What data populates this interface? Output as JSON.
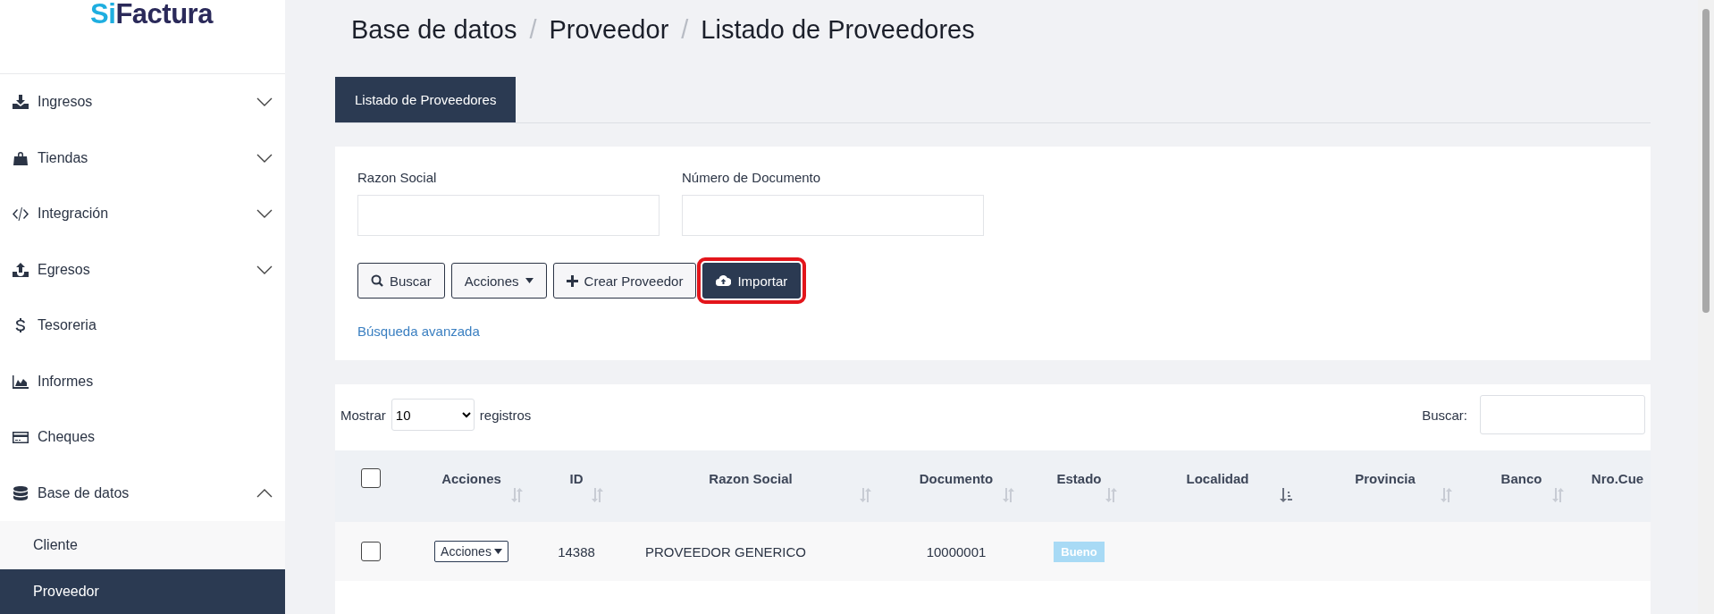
{
  "sidebar": {
    "logo": {
      "accent": "Si",
      "rest": "Factura"
    },
    "items": [
      {
        "label": "Ingresos",
        "expanded": false
      },
      {
        "label": "Tiendas",
        "expanded": false
      },
      {
        "label": "Integración",
        "expanded": false
      },
      {
        "label": "Egresos",
        "expanded": false
      },
      {
        "label": "Tesoreria"
      },
      {
        "label": "Informes"
      },
      {
        "label": "Cheques"
      },
      {
        "label": "Base de datos",
        "expanded": true,
        "children": [
          {
            "label": "Cliente",
            "selected": false
          },
          {
            "label": "Proveedor",
            "selected": true
          }
        ]
      }
    ]
  },
  "breadcrumb": {
    "separator": "/",
    "items": [
      "Base de datos",
      "Proveedor",
      "Listado de Proveedores"
    ]
  },
  "tabs": [
    {
      "label": "Listado de Proveedores",
      "selected": true
    }
  ],
  "filters": {
    "fields": [
      {
        "label": "Razon Social"
      },
      {
        "label": "Número de Documento"
      }
    ],
    "buttons": [
      {
        "label": "Buscar",
        "kind": "search",
        "highlighted": false
      },
      {
        "label": "Acciones",
        "kind": "dropdown",
        "highlighted": false
      },
      {
        "label": "Crear Proveedor",
        "kind": "create",
        "highlighted": false
      },
      {
        "label": "Importar",
        "kind": "import",
        "highlighted": true
      }
    ],
    "advanced_link": "Búsqueda avanzada"
  },
  "table": {
    "length_label_before": "Mostrar",
    "length_value": "10",
    "length_label_after": "registros",
    "search_label": "Buscar:",
    "select_all_checked": false,
    "columns": [
      {
        "label": "Acciones",
        "sorted": false
      },
      {
        "label": "ID",
        "sorted": false
      },
      {
        "label": "Razon Social",
        "sorted": false
      },
      {
        "label": "Documento",
        "sorted": false
      },
      {
        "label": "Estado",
        "sorted": false
      },
      {
        "label": "Localidad",
        "sorted": true
      },
      {
        "label": "Provincia",
        "sorted": false
      },
      {
        "label": "Banco",
        "sorted": false
      },
      {
        "label": "Nro.Cue"
      }
    ],
    "rows": [
      {
        "checked": false,
        "action": "Acciones",
        "id": "14388",
        "name": "PROVEEDOR GENERICO",
        "document": "10000001",
        "status": "Bueno",
        "color": "#a8daf5"
      }
    ]
  }
}
